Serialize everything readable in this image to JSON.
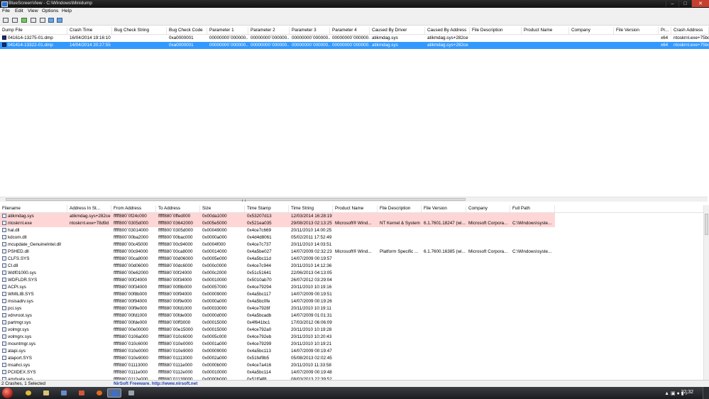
{
  "window": {
    "title": "BlueScreenView  -  C:\\Windows\\Minidump"
  },
  "menu": [
    "File",
    "Edit",
    "View",
    "Options",
    "Help"
  ],
  "toolbar": {
    "icons": [
      "save-icon",
      "open-icon",
      "refresh-icon",
      "copy-icon",
      "properties-icon",
      "html-report-icon",
      "about-icon"
    ]
  },
  "dumps": {
    "columns": [
      "Dump File",
      "Crash Time",
      "Bug Check String",
      "Bug Check Code",
      "Parameter 1",
      "Parameter 2",
      "Parameter 3",
      "Parameter 4",
      "Caused By Driver",
      "Caused By Address",
      "File Description",
      "Product Name",
      "Company",
      "File Version",
      "Pr...",
      "Crash Address"
    ],
    "rows": [
      [
        "041614-13275-01.dmp",
        "16/04/2014 19:16:10",
        "",
        "0xa0000001",
        "00000000`000000...",
        "00000000`000000...",
        "00000000`000000...",
        "00000000`000000...",
        "atikmdag.sys",
        "atikmdag.sys+282ce",
        "",
        "",
        "",
        "",
        "x64",
        "ntoskrnl.exe+75bc"
      ],
      [
        "041414-13322-01.dmp",
        "14/04/2014 20:27:55",
        "",
        "0xa0000001",
        "00000000`000000...",
        "00000000`000000...",
        "00000000`000000...",
        "00000000`000000...",
        "atikmdag.sys",
        "atikmdag.sys+282ce",
        "",
        "",
        "",
        "",
        "x64",
        "ntoskrnl.exe+75bc"
      ]
    ]
  },
  "drivers": {
    "columns": [
      "Filename",
      "Address In St...",
      "From Address",
      "To Address",
      "Size",
      "Time Stamp",
      "Time String",
      "Product Name",
      "File Description",
      "File Version",
      "Company",
      "Full Path"
    ],
    "rows": [
      [
        "atikmdag.sys",
        "atikmdag.sys+282ce",
        "fffff880`0f24c000",
        "fffff880`0ffed000",
        "0x00da1000",
        "0x53207d13",
        "12/03/2014 16:28:19",
        "",
        "",
        "",
        "",
        ""
      ],
      [
        "ntoskrnl.exe",
        "ntoskrnl.exe+78d9d",
        "fffff800`0305d000",
        "fffff800`03642000",
        "0x005e5000",
        "0x521ea035",
        "29/08/2013 02:13:25",
        "Microsoft® Wind...",
        "NT Kernel & System",
        "6.1.7601.18247 (wi...",
        "Microsoft Corpora...",
        "C:\\Windows\\syste..."
      ],
      [
        "hal.dll",
        "",
        "fffff800`03014000",
        "fffff800`0305d000",
        "0x00049000",
        "0x4ce7c669",
        "20/11/2010 14:00:25",
        "",
        "",
        "",
        "",
        ""
      ],
      [
        "kdcom.dll",
        "",
        "fffff800`00ba2000",
        "fffff800`00bac000",
        "0x0000a000",
        "0x4d4d8061",
        "05/02/2011 17:52:49",
        "",
        "",
        "",
        "",
        ""
      ],
      [
        "mcupdate_GenuineIntel.dll",
        "",
        "fffff880`00c45000",
        "fffff880`00c94000",
        "0x0004f000",
        "0x4ce7c737",
        "20/11/2010 14:03:51",
        "",
        "",
        "",
        "",
        ""
      ],
      [
        "PSHED.dll",
        "",
        "fffff880`00c94000",
        "fffff880`00ca8000",
        "0x00014000",
        "0x4a5be027",
        "14/07/2009 02:32:23",
        "Microsoft® Wind...",
        "Platform Specific ...",
        "6.1.7600.16385 (wi...",
        "Microsoft Corpora...",
        "C:\\Windows\\syste..."
      ],
      [
        "CLFS.SYS",
        "",
        "fffff880`00ca8000",
        "fffff880`00d06000",
        "0x0005e000",
        "0x4a5bc11d",
        "14/07/2009 00:19:57",
        "",
        "",
        "",
        "",
        ""
      ],
      [
        "CI.dll",
        "",
        "fffff880`00d06000",
        "fffff880`00dc6000",
        "0x000c0000",
        "0x4ce7c944",
        "20/11/2010 14:12:36",
        "",
        "",
        "",
        "",
        ""
      ],
      [
        "Wdf01000.sys",
        "",
        "fffff880`00e62000",
        "fffff880`00f24000",
        "0x000c2000",
        "0x51c51641",
        "22/06/2013 04:13:05",
        "",
        "",
        "",
        "",
        ""
      ],
      [
        "WDFLDR.SYS",
        "",
        "fffff880`00f24000",
        "fffff880`00f34000",
        "0x00010000",
        "0x5010ab70",
        "26/07/2012 03:29:04",
        "",
        "",
        "",
        "",
        ""
      ],
      [
        "ACPI.sys",
        "",
        "fffff880`00f34000",
        "fffff880`00f8b000",
        "0x00057000",
        "0x4ce79294",
        "20/11/2010 10:19:16",
        "",
        "",
        "",
        "",
        ""
      ],
      [
        "WMILIB.SYS",
        "",
        "fffff880`00f8b000",
        "fffff880`00f94000",
        "0x00009000",
        "0x4a5bc117",
        "14/07/2009 00:19:51",
        "",
        "",
        "",
        "",
        ""
      ],
      [
        "msisadrv.sys",
        "",
        "fffff880`00f94000",
        "fffff880`00f9e000",
        "0x0000a000",
        "0x4a5bc0fe",
        "14/07/2009 00:19:26",
        "",
        "",
        "",
        "",
        ""
      ],
      [
        "pci.sys",
        "",
        "fffff880`00f9e000",
        "fffff880`00fd1000",
        "0x00033000",
        "0x4ce7928f",
        "20/11/2010 10:19:11",
        "",
        "",
        "",
        "",
        ""
      ],
      [
        "vdrvroot.sys",
        "",
        "fffff880`00fd1000",
        "fffff880`00fde000",
        "0x0000d000",
        "0x4a5bcadb",
        "14/07/2009 01:01:31",
        "",
        "",
        "",
        "",
        ""
      ],
      [
        "partmgr.sys",
        "",
        "fffff880`00fde000",
        "fffff880`00ff3000",
        "0x00015000",
        "0x4f641bc1",
        "17/03/2012 06:06:09",
        "",
        "",
        "",
        "",
        ""
      ],
      [
        "volmgr.sys",
        "",
        "fffff880`00e00000",
        "fffff880`00e15000",
        "0x00015000",
        "0x4ce792a0",
        "20/11/2010 10:19:28",
        "",
        "",
        "",
        "",
        ""
      ],
      [
        "volmgrx.sys",
        "",
        "fffff880`0106a000",
        "fffff880`010c6000",
        "0x0005c000",
        "0x4ce792eb",
        "20/11/2010 10:20:43",
        "",
        "",
        "",
        "",
        ""
      ],
      [
        "mountmgr.sys",
        "",
        "fffff880`010c6000",
        "fffff880`010e0000",
        "0x0001a000",
        "0x4ce79299",
        "20/11/2010 10:19:21",
        "",
        "",
        "",
        "",
        ""
      ],
      [
        "atapi.sys",
        "",
        "fffff880`010e0000",
        "fffff880`010e9000",
        "0x00009000",
        "0x4a5bc113",
        "14/07/2009 00:19:47",
        "",
        "",
        "",
        "",
        ""
      ],
      [
        "ataport.SYS",
        "",
        "fffff880`010e9000",
        "fffff880`01113000",
        "0x0002a000",
        "0x51fef9b5",
        "05/08/2013 02:02:45",
        "",
        "",
        "",
        "",
        ""
      ],
      [
        "msahci.sys",
        "",
        "fffff880`01113000",
        "fffff880`0111e000",
        "0x0000b000",
        "0x4ce7a416",
        "20/11/2010 11:33:58",
        "",
        "",
        "",
        "",
        ""
      ],
      [
        "PCIIDEX.SYS",
        "",
        "fffff880`0111e000",
        "fffff880`0112e000",
        "0x00010000",
        "0x4a5bc114",
        "14/07/2009 00:19:48",
        "",
        "",
        "",
        "",
        ""
      ],
      [
        "amdxata.sys",
        "",
        "fffff880`0112e000",
        "fffff880`01139000",
        "0x0000b000",
        "0x51f04f8",
        "08/03/2013 22:39:52",
        "",
        "",
        "",
        "",
        ""
      ]
    ]
  },
  "status": {
    "text": "2 Crashes, 1 Selected",
    "link": "NirSoft Freeware.  http://www.nirsoft.net"
  },
  "taskbar": {
    "time": "22:32"
  }
}
